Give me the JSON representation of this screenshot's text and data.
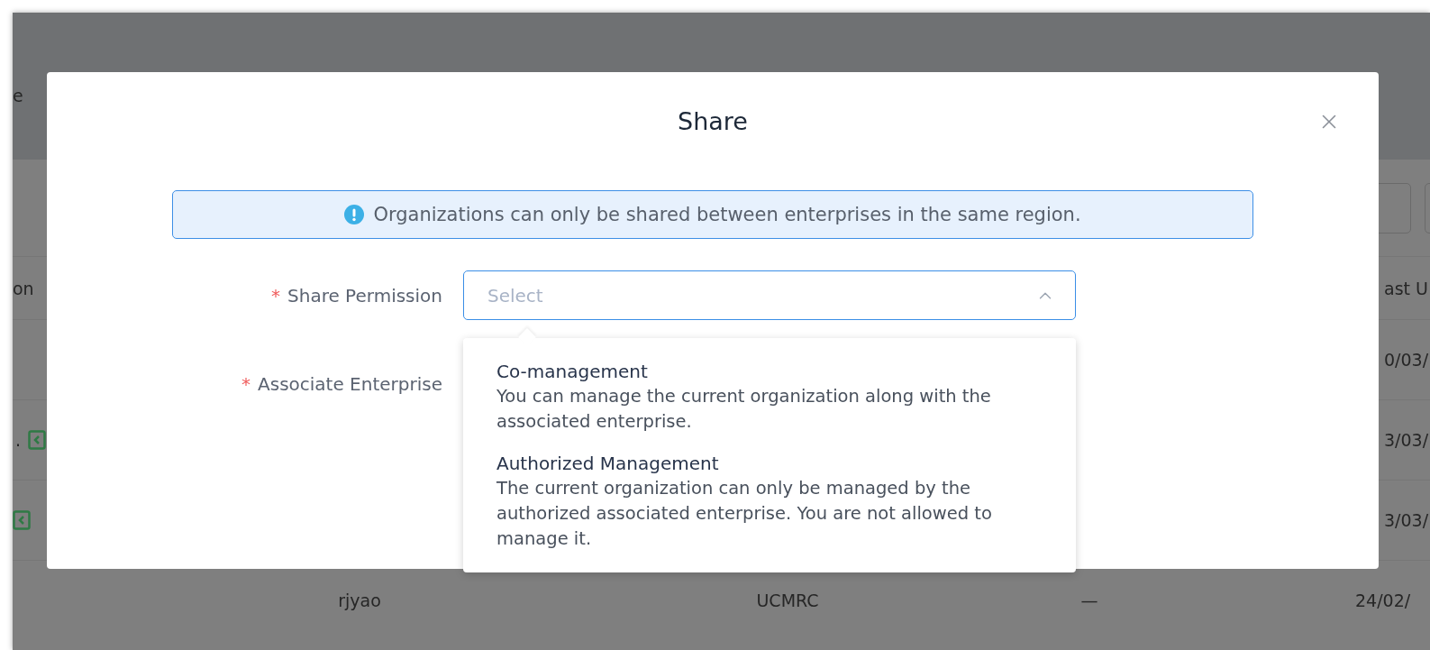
{
  "background": {
    "header": {
      "column_1": "e"
    },
    "table": {
      "columns": [
        "on",
        "ast U"
      ],
      "rows": [
        {
          "tag_icon": false,
          "column_5": "0/03/"
        },
        {
          "column_1": ".",
          "tag_icon": true,
          "column_5": "3/03/"
        },
        {
          "tag_icon": true,
          "column_5": "3/03/"
        },
        {
          "tag_icon": false,
          "column_2": "rjyao",
          "column_3": "UCMRC",
          "column_4": "—",
          "column_5": "24/02/"
        }
      ]
    }
  },
  "modal": {
    "title": "Share",
    "alert": "Organizations can only be shared between enterprises in the same region.",
    "fields": [
      {
        "label": "Share Permission",
        "required_mark": "*",
        "kind": "select",
        "placeholder": "Select",
        "expanded": true,
        "options": [
          {
            "title": "Co-management",
            "description": "You can manage the current organization along with the associated enterprise."
          },
          {
            "title": "Authorized Management",
            "description": "The current organization can only be managed by the authorized associated enterprise. You are not allowed to manage it."
          }
        ]
      },
      {
        "label": "Associate Enterprise",
        "required_mark": "*",
        "kind": "covered"
      }
    ]
  }
}
